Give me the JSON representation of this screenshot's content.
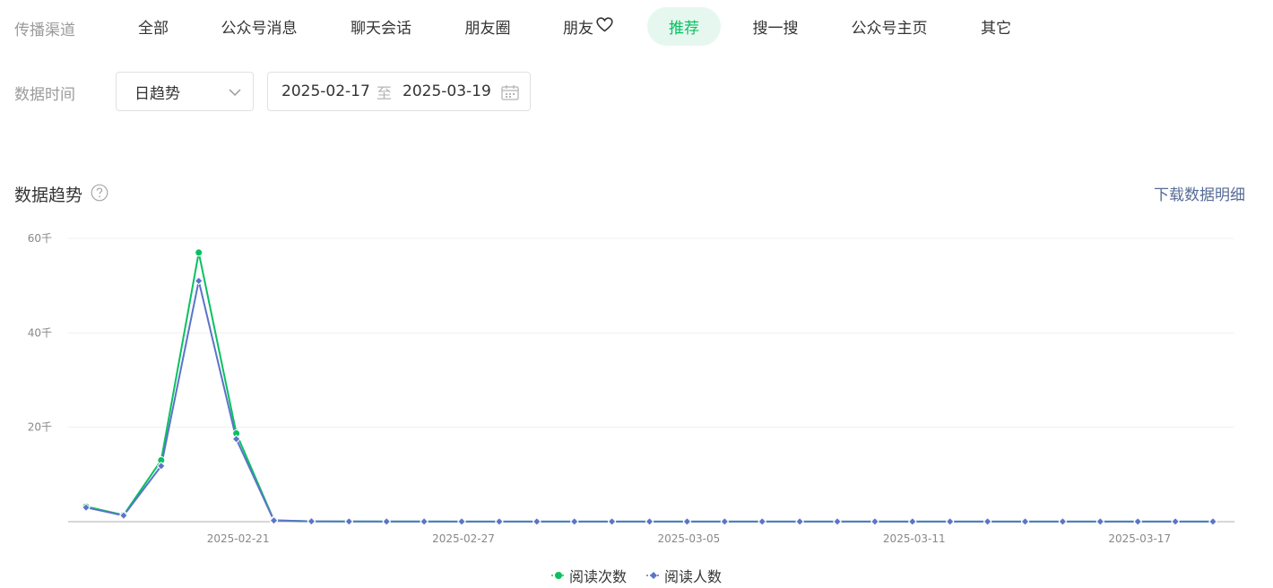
{
  "filters": {
    "channel_label": "传播渠道",
    "channels": [
      {
        "label": "全部",
        "active": false
      },
      {
        "label": "公众号消息",
        "active": false
      },
      {
        "label": "聊天会话",
        "active": false
      },
      {
        "label": "朋友圈",
        "active": false
      },
      {
        "label": "朋友",
        "active": false,
        "icon": "heart-icon"
      },
      {
        "label": "推荐",
        "active": true
      },
      {
        "label": "搜一搜",
        "active": false
      },
      {
        "label": "公众号主页",
        "active": false
      },
      {
        "label": "其它",
        "active": false
      }
    ],
    "time_label": "数据时间",
    "granularity": "日趋势",
    "date_start": "2025-02-17",
    "date_separator": "至",
    "date_end": "2025-03-19"
  },
  "trend": {
    "title": "数据趋势",
    "download_label": "下载数据明细"
  },
  "colors": {
    "accent": "#07c160",
    "accent_bg": "#e6f7ef",
    "series_read_count": "#07c160",
    "series_reader_count": "#5b74c8",
    "link": "#576b95"
  },
  "chart_data": {
    "type": "line",
    "x": [
      "2025-02-17",
      "2025-02-18",
      "2025-02-19",
      "2025-02-20",
      "2025-02-21",
      "2025-02-22",
      "2025-02-23",
      "2025-02-24",
      "2025-02-25",
      "2025-02-26",
      "2025-02-27",
      "2025-02-28",
      "2025-03-01",
      "2025-03-02",
      "2025-03-03",
      "2025-03-04",
      "2025-03-05",
      "2025-03-06",
      "2025-03-07",
      "2025-03-08",
      "2025-03-09",
      "2025-03-10",
      "2025-03-11",
      "2025-03-12",
      "2025-03-13",
      "2025-03-14",
      "2025-03-15",
      "2025-03-16",
      "2025-03-17",
      "2025-03-18",
      "2025-03-19"
    ],
    "x_tick_labels": [
      "2025-02-21",
      "2025-02-27",
      "2025-03-05",
      "2025-03-11",
      "2025-03-17"
    ],
    "y_tick_labels": [
      "60千",
      "40千",
      "20千"
    ],
    "y_ticks": [
      60000,
      40000,
      20000
    ],
    "ylim": [
      0,
      60000
    ],
    "grid": true,
    "legend_position": "bottom",
    "series": [
      {
        "name": "阅读次数",
        "marker": "circle",
        "values": [
          3200,
          1400,
          13000,
          57000,
          18700,
          300,
          80,
          50,
          40,
          40,
          30,
          30,
          30,
          30,
          20,
          20,
          20,
          20,
          20,
          20,
          20,
          20,
          20,
          20,
          20,
          20,
          20,
          20,
          20,
          20,
          20
        ]
      },
      {
        "name": "阅读人数",
        "marker": "diamond",
        "values": [
          3000,
          1300,
          11800,
          51000,
          17500,
          250,
          70,
          40,
          30,
          30,
          20,
          20,
          20,
          20,
          20,
          20,
          20,
          20,
          20,
          20,
          20,
          20,
          20,
          20,
          20,
          20,
          20,
          20,
          20,
          20,
          20
        ]
      }
    ]
  }
}
